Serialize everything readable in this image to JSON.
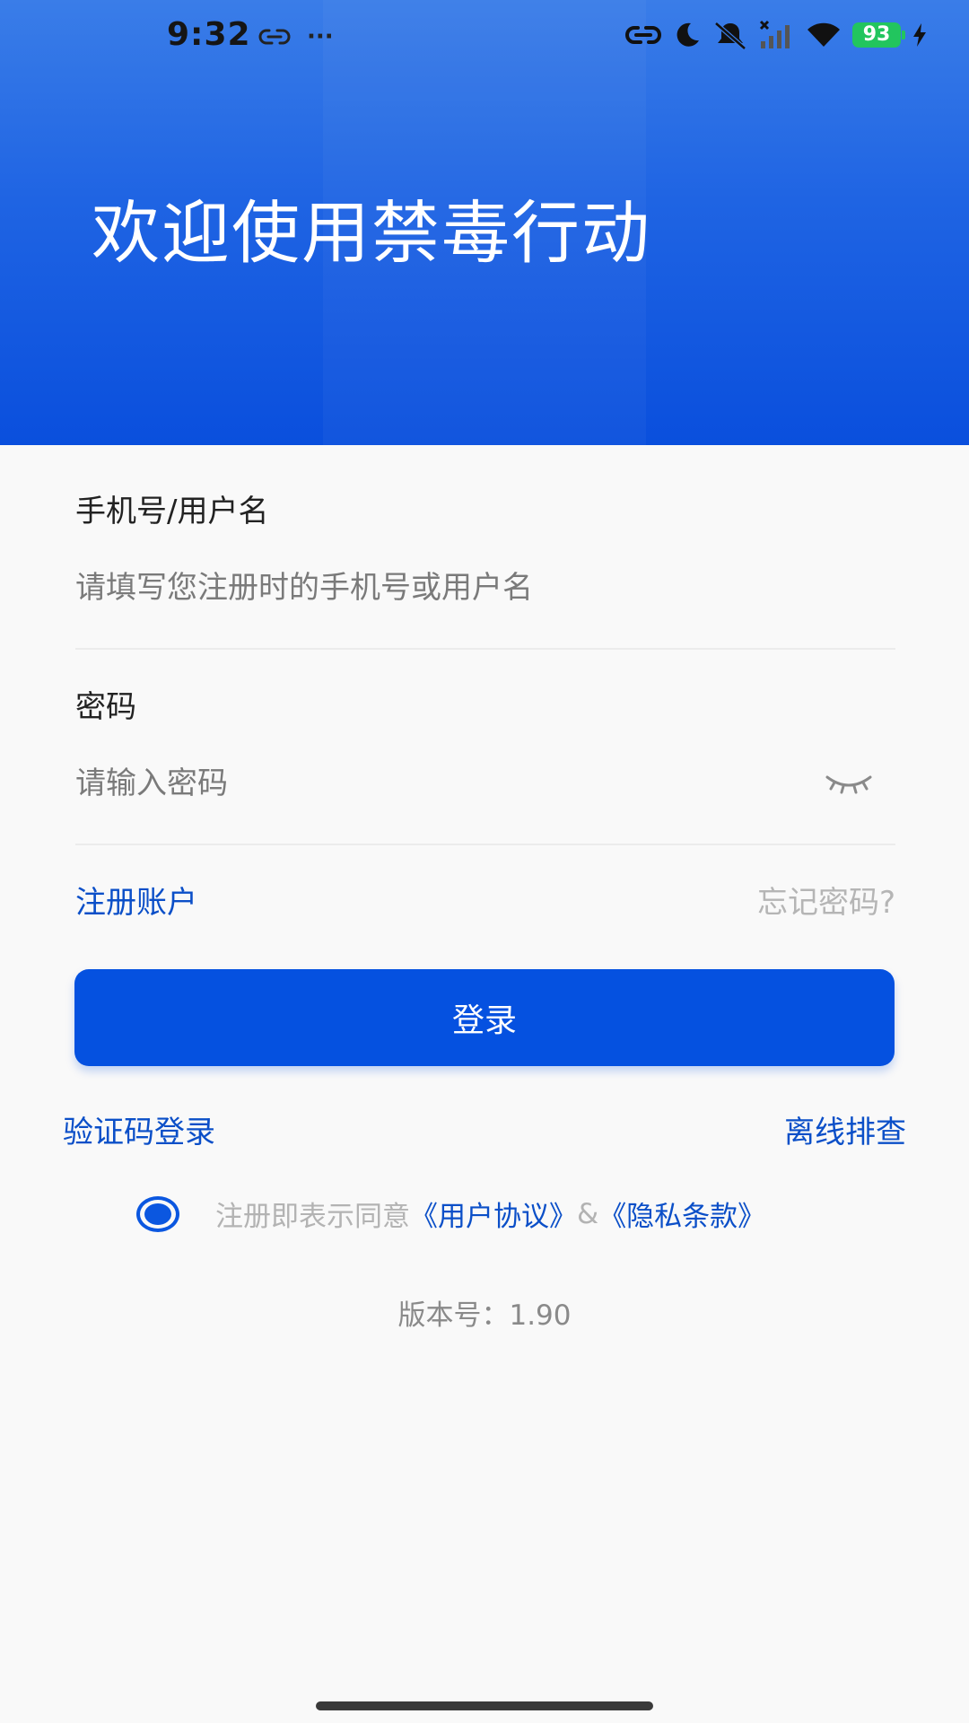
{
  "status_bar": {
    "time": "9:32",
    "more": "···",
    "battery": "93"
  },
  "header": {
    "title": "欢迎使用禁毒行动"
  },
  "username": {
    "label": "手机号/用户名",
    "placeholder": "请填写您注册时的手机号或用户名"
  },
  "password": {
    "label": "密码",
    "placeholder": "请输入密码"
  },
  "links": {
    "register": "注册账户",
    "forgot": "忘记密码?"
  },
  "login_button": "登录",
  "alt_links": {
    "code_login": "验证码登录",
    "offline_check": "离线排查"
  },
  "agreement": {
    "prefix": "注册即表示同意",
    "user_agreement": "《用户协议》",
    "amp": "&",
    "privacy": "《隐私条款》"
  },
  "version": "版本号：1.90",
  "colors": {
    "primary": "#0551e0",
    "link": "#0b4fc8",
    "battery": "#22c55e"
  }
}
